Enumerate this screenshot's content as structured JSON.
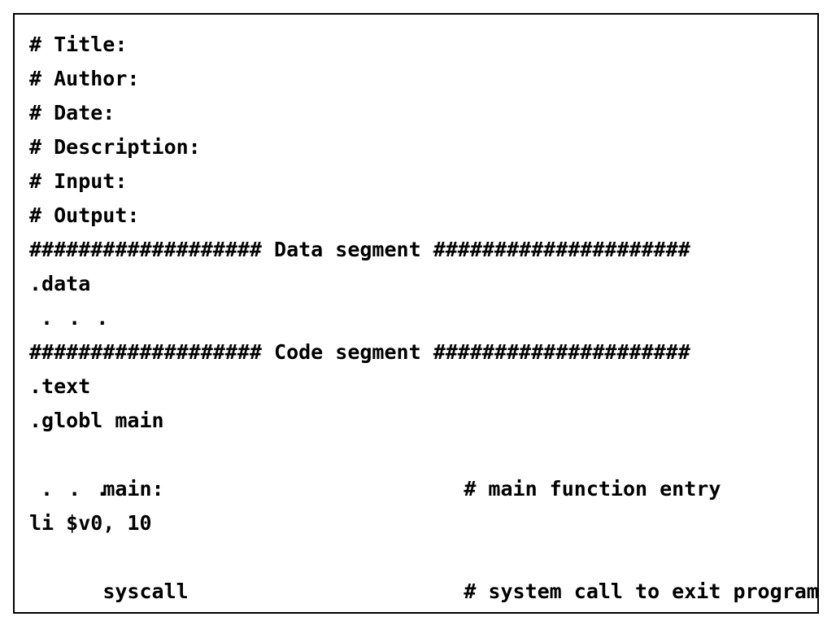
{
  "header_comments": [
    "# Title:",
    "# Author:",
    "# Date:",
    "# Description:",
    "# Input:",
    "# Output:"
  ],
  "data_segment_banner": "################### Data segment #####################",
  "data_directive": ".data",
  "ellipsis": ". . .",
  "code_segment_banner": "################### Code segment #####################",
  "text_directive": ".text",
  "globl_directive": ".globl main",
  "main_label": "main:",
  "main_comment": "# main function entry",
  "li_instruction": "li $v0, 10",
  "syscall_instruction": "syscall",
  "syscall_comment": "# system call to exit program"
}
